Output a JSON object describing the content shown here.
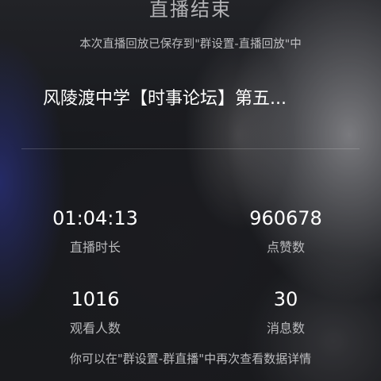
{
  "header": {
    "title": "直播结束",
    "subtitle": "本次直播回放已保存到\"群设置-直播回放\"中"
  },
  "live": {
    "room_name": "风陵渡中学【时事论坛】第五..."
  },
  "stats": [
    {
      "value": "01:04:13",
      "label": "直播时长"
    },
    {
      "value": "960678",
      "label": "点赞数"
    },
    {
      "value": "1016",
      "label": "观看人数"
    },
    {
      "value": "30",
      "label": "消息数"
    }
  ],
  "footer": {
    "hint": "你可以在\"群设置-群直播\"中再次查看数据详情"
  },
  "colors": {
    "text_primary": "#ffffff",
    "text_secondary": "#e1e1e4",
    "background": "#1b1d22",
    "left_glow": "#3c46c8"
  }
}
